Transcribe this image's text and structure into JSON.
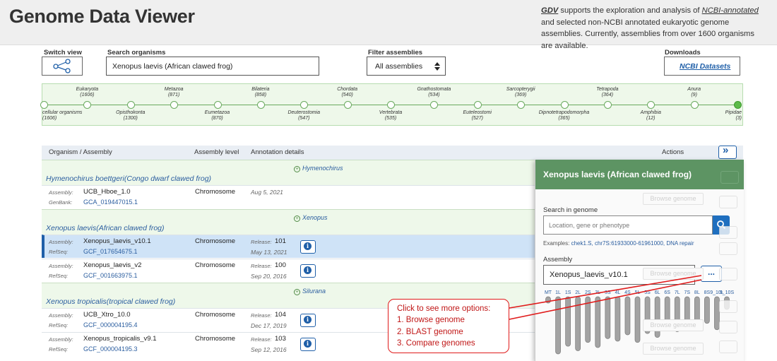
{
  "header": {
    "title": "Genome Data Viewer",
    "intro": {
      "gdv": "GDV",
      "part1": " supports the exploration and analysis of ",
      "ncbi": "NCBI-annotated",
      "part2": " and selected non-NCBI annotated eukaryotic genome assemblies. Currently, assemblies from over 1600 organisms are available."
    }
  },
  "controls": {
    "switch_view_label": "Switch view",
    "search_label": "Search organisms",
    "search_value": "Xenopus laevis (African clawed frog)",
    "filter_label": "Filter assemblies",
    "filter_value": "All assemblies",
    "downloads_label": "Downloads",
    "datasets_link": "NCBI Datasets"
  },
  "taxonomy": [
    {
      "name": "cellular organisms",
      "count": "(1606)",
      "pos": "bottom"
    },
    {
      "name": "Eukaryota",
      "count": "(1606)",
      "pos": "top"
    },
    {
      "name": "Opisthokonta",
      "count": "(1300)",
      "pos": "bottom"
    },
    {
      "name": "Metazoa",
      "count": "(871)",
      "pos": "top"
    },
    {
      "name": "Eumetazoa",
      "count": "(870)",
      "pos": "bottom"
    },
    {
      "name": "Bilateria",
      "count": "(858)",
      "pos": "top"
    },
    {
      "name": "Deuterostomia",
      "count": "(547)",
      "pos": "bottom"
    },
    {
      "name": "Chordata",
      "count": "(540)",
      "pos": "top"
    },
    {
      "name": "Vertebrata",
      "count": "(535)",
      "pos": "bottom"
    },
    {
      "name": "Gnathostomata",
      "count": "(534)",
      "pos": "top"
    },
    {
      "name": "Euteleostomi",
      "count": "(527)",
      "pos": "bottom"
    },
    {
      "name": "Sarcopterygii",
      "count": "(369)",
      "pos": "top"
    },
    {
      "name": "Dipnotetrapodomorpha",
      "count": "(365)",
      "pos": "bottom"
    },
    {
      "name": "Tetrapoda",
      "count": "(364)",
      "pos": "top"
    },
    {
      "name": "Amphibia",
      "count": "(12)",
      "pos": "bottom"
    },
    {
      "name": "Anura",
      "count": "(9)",
      "pos": "top"
    },
    {
      "name": "Pipidae",
      "count": "(3)",
      "pos": "bottom"
    }
  ],
  "table": {
    "columns": [
      "Organism / Assembly",
      "Assembly level",
      "Annotation details",
      "Actions"
    ],
    "assembly_label": "Assembly:",
    "genbank_label": "GenBank:",
    "refseq_label": "RefSeq:",
    "release_label": "Release:",
    "groups": [
      {
        "genus": "Hymenochirus",
        "organism": "Hymenochirus boettgeri(Congo dwarf clawed frog)",
        "rows": [
          {
            "assembly": "UCB_Hboe_1.0",
            "acc_type": "GenBank:",
            "accession": "GCA_019447015.1",
            "level": "Chromosome",
            "release": "",
            "date": "Aug 5, 2021"
          }
        ]
      },
      {
        "genus": "Xenopus",
        "organism": "Xenopus laevis(African clawed frog)",
        "rows": [
          {
            "assembly": "Xenopus_laevis_v10.1",
            "acc_type": "RefSeq:",
            "accession": "GCF_017654675.1",
            "level": "Chromosome",
            "release": "101",
            "date": "May 13, 2021"
          },
          {
            "assembly": "Xenopus_laevis_v2",
            "acc_type": "RefSeq:",
            "accession": "GCF_001663975.1",
            "level": "Chromosome",
            "release": "100",
            "date": "Sep 20, 2016"
          }
        ]
      },
      {
        "genus": "Silurana",
        "organism": "Xenopus tropicalis(tropical clawed frog)",
        "rows": [
          {
            "assembly": "UCB_Xtro_10.0",
            "acc_type": "RefSeq:",
            "accession": "GCF_000004195.4",
            "level": "Chromosome",
            "release": "104",
            "date": "Dec 17, 2019"
          },
          {
            "assembly": "Xenopus_tropicalis_v9.1",
            "acc_type": "RefSeq:",
            "accession": "GCF_000004195.3",
            "level": "Chromosome",
            "release": "103",
            "date": "Sep 12, 2016"
          }
        ]
      }
    ]
  },
  "panel": {
    "title": "Xenopus laevis (African clawed frog)",
    "search_label": "Search in genome",
    "search_placeholder": "Location, gene or phenotype",
    "examples_label": "Examples:",
    "examples": "chek1.S, chr7S:61933000-61961000, DNA repair",
    "assembly_label": "Assembly",
    "assembly_value": "Xenopus_laevis_v10.1",
    "more_button": "...",
    "browse_genome": "Browse genome",
    "chromosomes": [
      "MT",
      "1L",
      "1S",
      "2L",
      "2S",
      "3L",
      "3S",
      "4L",
      "4S",
      "5L",
      "5S",
      "6L",
      "6S",
      "7L",
      "7S",
      "8L",
      "8S",
      "9_10L",
      "9_10S"
    ],
    "chrom_levels": [
      0.1,
      0.9,
      0.78,
      0.85,
      0.72,
      0.8,
      0.66,
      0.7,
      0.6,
      0.72,
      0.58,
      0.64,
      0.52,
      0.55,
      0.47,
      0.5,
      0.42,
      0.52,
      0.2
    ]
  },
  "callout": {
    "line1": "Click to see more options:",
    "line2": "1. Browse genome",
    "line3": "2. BLAST genome",
    "line4": "3. Compare genomes"
  },
  "colors": {
    "accent": "#1f5fa8",
    "panel_header": "#5d9463",
    "callout": "#e01b1b",
    "taxonomy_bg": "#eef8ea"
  }
}
